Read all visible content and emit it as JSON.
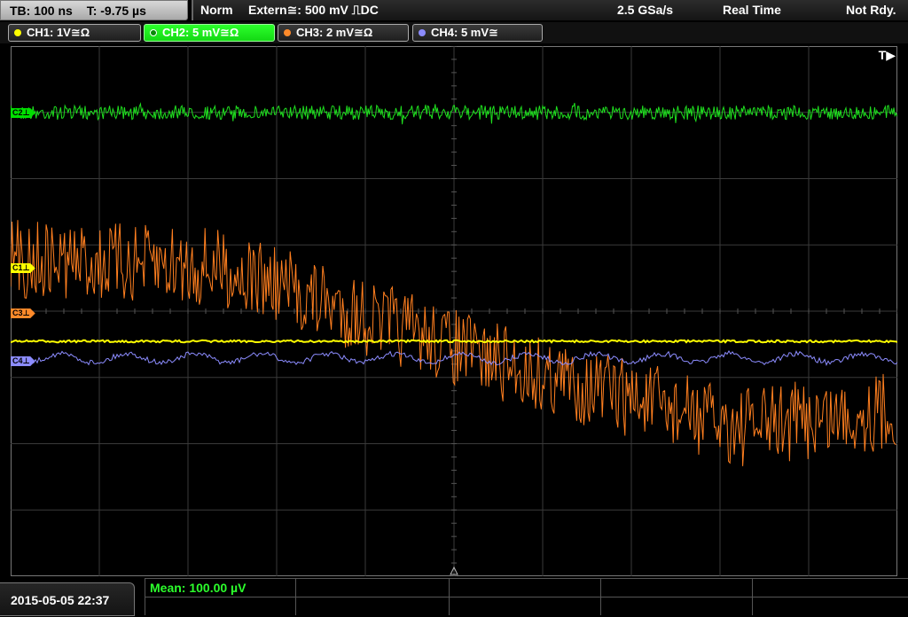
{
  "timebase": {
    "tb": "TB: 100 ns",
    "trigger_time": "T: -9.75 µs"
  },
  "trigger": {
    "mode": "Norm",
    "source": "Extern≅: 500 mV ⎍DC",
    "sample_rate": "2.5 GSa/s",
    "acq_mode": "Real Time",
    "status": "Not Rdy."
  },
  "channels": [
    {
      "label": "CH1: 1V≅Ω",
      "color": "#ffff00"
    },
    {
      "label": "CH2: 5 mV≅Ω",
      "color": "#00e000"
    },
    {
      "label": "CH3: 2 mV≅Ω",
      "color": "#ff8a2a"
    },
    {
      "label": "CH4: 5 mV≅",
      "color": "#8c8cff"
    }
  ],
  "markers": {
    "trigger": "T▶",
    "c1": "C1⊥",
    "c3": "C3⊥",
    "c4": "C4⊥",
    "c2": "C2⊥"
  },
  "measurement": {
    "mean": "Mean: 100.00 µV"
  },
  "datetime": "2015-05-05 22:37"
}
